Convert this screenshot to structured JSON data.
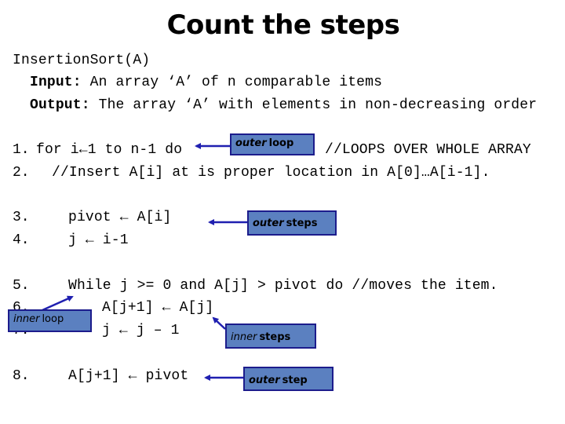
{
  "slide": {
    "title": "Count the steps"
  },
  "header": {
    "signature": "InsertionSort(A)",
    "input_label": "Input:",
    "input_text": " An array ‘A’ of n comparable items",
    "output_label": "Output:",
    "output_text": " The array ‘A’ with elements in non-decreasing order"
  },
  "code_lines": [
    {
      "num": "1.",
      "text": "for i←1 to n-1 do",
      "comment": "//LOOPS OVER WHOLE ARRAY"
    },
    {
      "num": "2.",
      "text": "//Insert A[i] at is proper location in A[0]…A[i-1]."
    },
    {
      "num": "3.",
      "text": "pivot ← A[i]"
    },
    {
      "num": "4.",
      "text": "j ← i-1"
    },
    {
      "num": "5.",
      "text": "While j >= 0 and A[j] > pivot do //moves the item."
    },
    {
      "num": "6.",
      "text": "A[j+1] ← A[j]"
    },
    {
      "num": "7.",
      "text": "j ← j – 1"
    },
    {
      "num": "8.",
      "text": "A[j+1] ← pivot"
    }
  ],
  "callouts": {
    "outer_loop": {
      "emph": "outer",
      "rest": "loop"
    },
    "outer_steps": {
      "emph": "outer",
      "rest": "steps"
    },
    "inner_loop": {
      "emph": "inner",
      "rest": "loop"
    },
    "inner_steps": {
      "emph": "inner",
      "rest": "steps"
    },
    "outer_step": {
      "emph": "outer",
      "rest": "step"
    }
  },
  "colors": {
    "callout_fill": "#5b80c0",
    "callout_border": "#1c1c8c",
    "arrow": "#1f1fb0"
  }
}
